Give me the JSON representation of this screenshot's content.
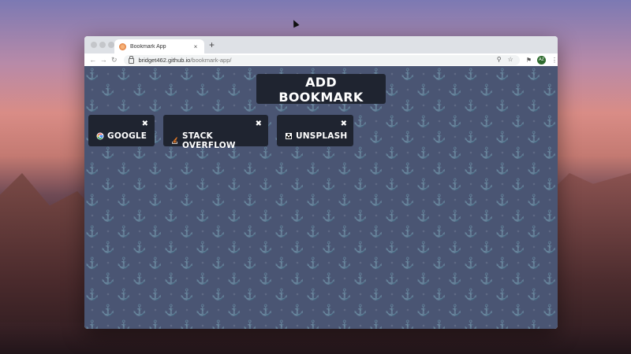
{
  "browser": {
    "tab_title": "Bookmark App",
    "tab_close": "×",
    "new_tab": "+",
    "url_host": "bridget462.github.io",
    "url_path": "/bookmark-app/",
    "avatar_initials": "AZ"
  },
  "app": {
    "add_button_label": "ADD BOOKMARK",
    "close_glyph": "✖",
    "bookmarks": [
      {
        "label": "GOOGLE",
        "icon": "google-icon"
      },
      {
        "label": "STACK OVERFLOW",
        "icon": "stack-overflow-icon"
      },
      {
        "label": "UNSPLASH",
        "icon": "unsplash-icon"
      }
    ]
  },
  "colors": {
    "page_bg": "#4a5573",
    "card_bg": "#1f2430",
    "text": "#ffffff"
  }
}
